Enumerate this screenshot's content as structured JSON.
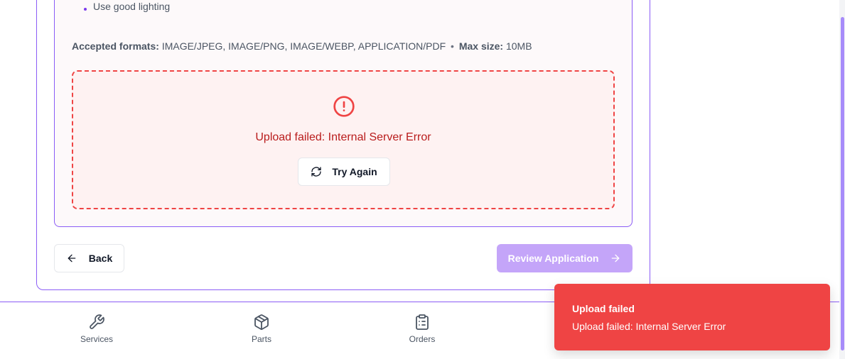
{
  "upload": {
    "tip_item": "Use good lighting",
    "formats_label": "Accepted formats:",
    "formats_value": "IMAGE/JPEG, IMAGE/PNG, IMAGE/WEBP, APPLICATION/PDF",
    "separator": "•",
    "max_size_label": "Max size:",
    "max_size_value": "10MB",
    "error_message": "Upload failed: Internal Server Error",
    "retry_label": "Try Again",
    "icons": {
      "error": "alert-circle-icon",
      "retry": "refresh-icon"
    }
  },
  "footer": {
    "back_label": "Back",
    "review_label": "Review Application",
    "icons": {
      "back": "arrow-left-icon",
      "review": "arrow-right-icon"
    }
  },
  "bottom_nav": {
    "items": [
      {
        "label": "Services",
        "icon": "wrench-icon"
      },
      {
        "label": "Parts",
        "icon": "package-icon"
      },
      {
        "label": "Orders",
        "icon": "clipboard-list-icon"
      }
    ]
  },
  "toast": {
    "title": "Upload failed",
    "description": "Upload failed: Internal Server Error",
    "color": "#ef4444"
  },
  "colors": {
    "accent": "#8b5cf6",
    "error": "#ef4444",
    "error_text": "#b91c1c",
    "disabled_button": "#c4a5f9"
  }
}
